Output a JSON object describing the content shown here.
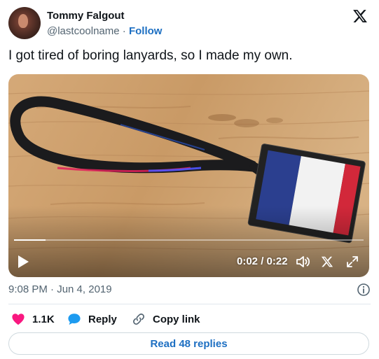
{
  "author": {
    "name": "Tommy Falgout",
    "handle": "@lastcoolname",
    "separator": "·",
    "follow_label": "Follow"
  },
  "tweet": {
    "text": "I got tired of boring lanyards, so I made my own."
  },
  "media": {
    "time_display": "0:02 / 0:22",
    "progress": 0.09
  },
  "meta": {
    "timestamp": "9:08 PM · Jun 4, 2019"
  },
  "actions": {
    "like_count": "1.1K",
    "reply_label": "Reply",
    "copy_label": "Copy link"
  },
  "read_replies_label": "Read 48 replies",
  "colors": {
    "accent": "#1d6fc2",
    "like": "#f91880",
    "reply": "#1d9bf0",
    "text": "#0f1419",
    "muted": "#536471"
  },
  "icons": [
    "x-logo-icon",
    "play-icon",
    "volume-icon",
    "x-watermark-icon",
    "expand-icon",
    "info-icon",
    "heart-icon",
    "reply-bubble-icon",
    "link-icon"
  ]
}
